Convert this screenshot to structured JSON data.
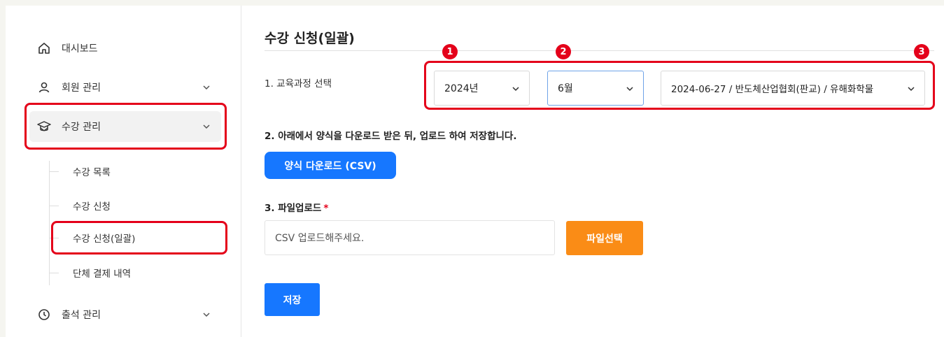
{
  "sidebar": {
    "items": [
      {
        "label": "대시보드",
        "icon": "home-icon"
      },
      {
        "label": "회원 관리",
        "icon": "user-icon"
      },
      {
        "label": "수강 관리",
        "icon": "graduation-cap-icon"
      },
      {
        "label": "출석 관리",
        "icon": "clock-icon"
      }
    ],
    "sub_items": [
      {
        "label": "수강 목록"
      },
      {
        "label": "수강 신청"
      },
      {
        "label": "수강 신청(일괄)"
      },
      {
        "label": "단체 결제 내역"
      }
    ]
  },
  "main": {
    "title": "수강 신청(일괄)",
    "step1": {
      "label": "1. 교육과정 선택",
      "year": "2024년",
      "month": "6월",
      "course": "2024-06-27 / 반도체산업협회(판교) / 유해화학물"
    },
    "step2": {
      "label": "2. 아래에서 양식을 다운로드 받은 뒤, 업로드 하여 저장합니다.",
      "download_button": "양식 다운로드 (CSV)"
    },
    "step3": {
      "label": "3. 파일업로드",
      "required_mark": "*",
      "placeholder": "CSV 업로드해주세요.",
      "file_button": "파일선택"
    },
    "save_button": "저장"
  },
  "badges": [
    "1",
    "2",
    "3"
  ],
  "colors": {
    "highlight": "#e4001a",
    "primary": "#1677ff",
    "file_button": "#fa8c16"
  }
}
